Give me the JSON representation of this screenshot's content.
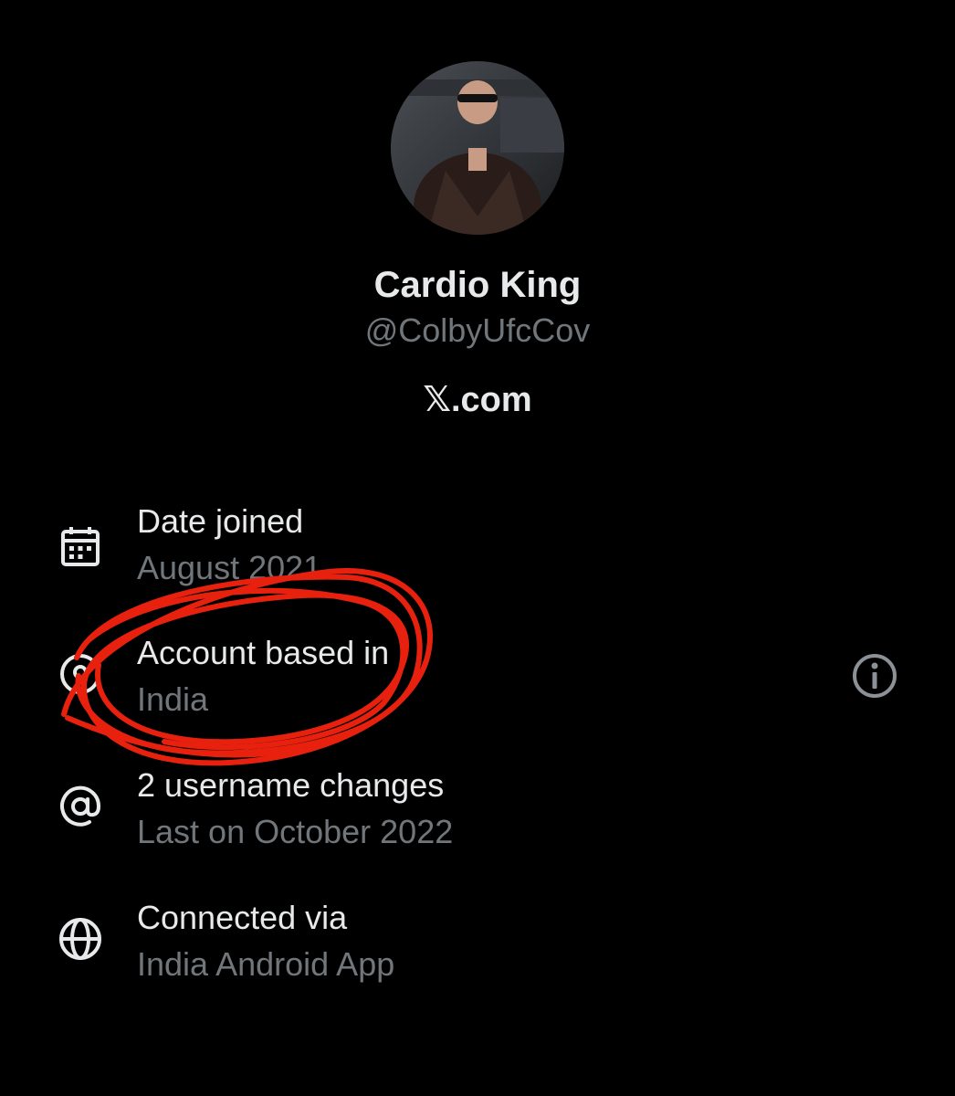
{
  "profile": {
    "display_name": "Cardio King",
    "handle": "@ColbyUfcCov",
    "site": "𝕏.com"
  },
  "about": {
    "rows": [
      {
        "icon": "calendar-icon",
        "title": "Date joined",
        "value": "August 2021"
      },
      {
        "icon": "location-pin-icon",
        "title": "Account based in",
        "value": "India"
      },
      {
        "icon": "at-sign-icon",
        "title": "2 username changes",
        "value": "Last on October 2022"
      },
      {
        "icon": "globe-icon",
        "title": "Connected via",
        "value": "India Android App"
      }
    ],
    "info_icon": "info-icon"
  },
  "colors": {
    "background": "#000000",
    "primary_text": "#e7e9ea",
    "secondary_text": "#71767b",
    "annotation": "#e8210f"
  }
}
